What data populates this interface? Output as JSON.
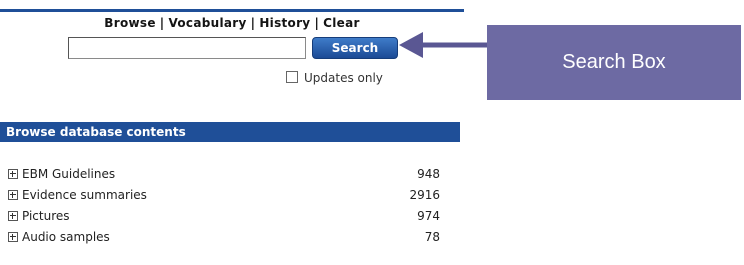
{
  "nav": {
    "browse": "Browse",
    "vocabulary": "Vocabulary",
    "history": "History",
    "clear": "Clear",
    "separator": "|"
  },
  "search": {
    "value": "",
    "placeholder": "",
    "button_label": "Search"
  },
  "updates_only": {
    "label": "Updates only",
    "checked": false
  },
  "browse_section": {
    "title": "Browse database contents",
    "items": [
      {
        "label": "EBM Guidelines",
        "count": "948"
      },
      {
        "label": "Evidence summaries",
        "count": "2916"
      },
      {
        "label": "Pictures",
        "count": "974"
      },
      {
        "label": "Audio samples",
        "count": "78"
      }
    ]
  },
  "annotation": {
    "label": "Search Box",
    "color": "#6d6aa3"
  },
  "colors": {
    "brand_blue": "#1f4f98"
  }
}
